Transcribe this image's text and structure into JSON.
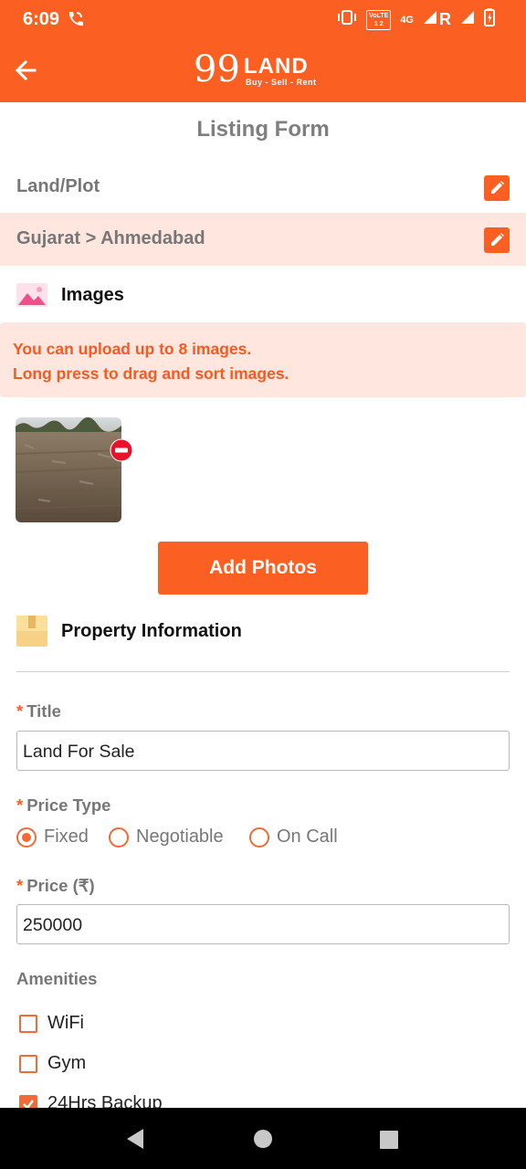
{
  "status_bar": {
    "time": "6:09",
    "volte_label": "VoLTE",
    "network": "4G",
    "roaming": "R"
  },
  "header": {
    "logo_number": "99",
    "logo_text": "LAND",
    "logo_tagline": "Buy - Sell - Rent"
  },
  "form_title": "Listing Form",
  "category_row": {
    "label": "Land/Plot"
  },
  "location_row": {
    "label": "Gujarat > Ahmedabad"
  },
  "images_section": {
    "title": "Images",
    "notice_line1": "You can upload up to 8 images.",
    "notice_line2": "Long press to drag and sort images.",
    "add_photos_label": "Add Photos"
  },
  "property_section": {
    "title": "Property Information",
    "title_field": {
      "required_mark": "*",
      "label": "Title",
      "value": "Land For Sale"
    },
    "price_type": {
      "required_mark": "*",
      "label": "Price Type",
      "options": [
        "Fixed",
        "Negotiable",
        "On Call"
      ],
      "selected": "Fixed"
    },
    "price_field": {
      "required_mark": "*",
      "label": "Price (₹)",
      "value": "250000"
    },
    "amenities": {
      "label": "Amenities",
      "items": [
        {
          "label": "WiFi",
          "checked": false
        },
        {
          "label": "Gym",
          "checked": false
        },
        {
          "label": "24Hrs Backup",
          "checked": true
        }
      ]
    }
  },
  "colors": {
    "brand": "#fb5f22",
    "tint": "#ffe6de",
    "label_gray": "#777777"
  }
}
